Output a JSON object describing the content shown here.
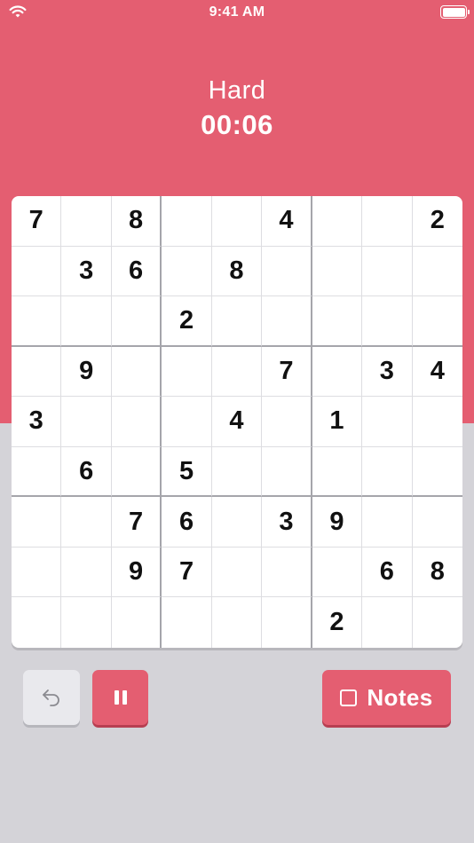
{
  "status_bar": {
    "time": "9:41 AM"
  },
  "header": {
    "difficulty": "Hard",
    "timer": "00:06"
  },
  "board": {
    "rows": [
      [
        "7",
        "",
        "8",
        "",
        "",
        "4",
        "",
        "",
        "2"
      ],
      [
        "",
        "3",
        "6",
        "",
        "8",
        "",
        "",
        "",
        ""
      ],
      [
        "",
        "",
        "",
        "2",
        "",
        "",
        "",
        "",
        ""
      ],
      [
        "",
        "9",
        "",
        "",
        "",
        "7",
        "",
        "3",
        "4"
      ],
      [
        "3",
        "",
        "",
        "",
        "4",
        "",
        "1",
        "",
        ""
      ],
      [
        "",
        "6",
        "",
        "5",
        "",
        "",
        "",
        "",
        ""
      ],
      [
        "",
        "",
        "7",
        "6",
        "",
        "3",
        "9",
        "",
        ""
      ],
      [
        "",
        "",
        "9",
        "7",
        "",
        "",
        "",
        "6",
        "8"
      ],
      [
        "",
        "",
        "",
        "",
        "",
        "",
        "2",
        "",
        ""
      ]
    ]
  },
  "controls": {
    "notes_label": "Notes"
  },
  "colors": {
    "accent": "#e45e71",
    "background": "#d4d3d8"
  }
}
